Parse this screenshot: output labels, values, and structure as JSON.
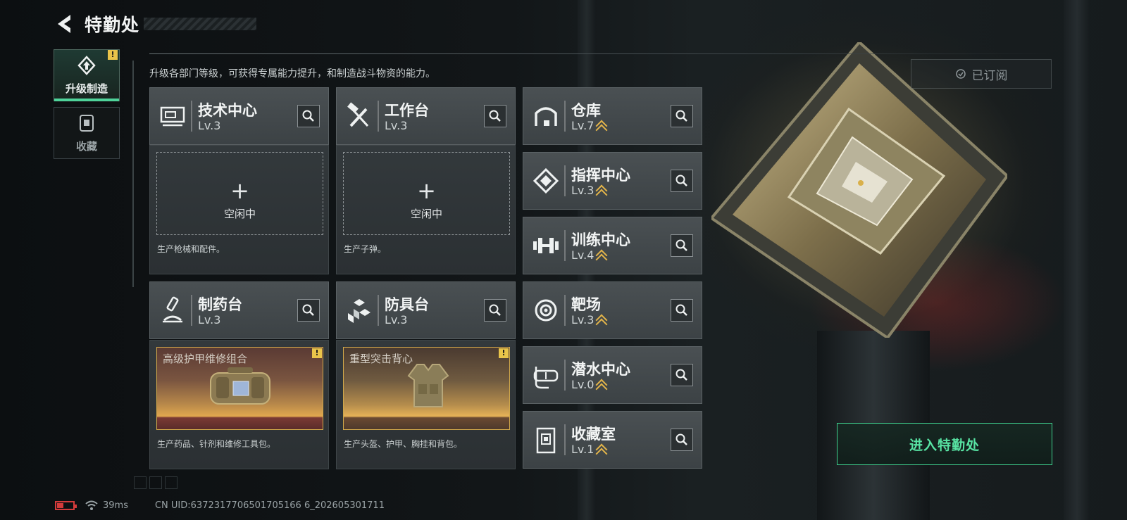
{
  "header": {
    "title": "特勤处"
  },
  "nav": [
    {
      "label": "升级制造",
      "icon": "upgrade-icon",
      "active": true,
      "alert": "!"
    },
    {
      "label": "收藏",
      "icon": "collection-icon",
      "active": false
    }
  ],
  "description": "升级各部门等级，可获得专属能力提升，和制造战斗物资的能力。",
  "departments_left": [
    {
      "name": "技术中心",
      "level": "Lv.3",
      "icon": "tech-center-icon",
      "slot_state": "空闲中",
      "slot_plus": "+",
      "desc": "生产枪械和配件。"
    },
    {
      "name": "工作台",
      "level": "Lv.3",
      "icon": "workbench-icon",
      "slot_state": "空闲中",
      "slot_plus": "+",
      "desc": "生产子弹。"
    },
    {
      "name": "制药台",
      "level": "Lv.3",
      "icon": "pharmacy-icon",
      "craft_item": "高级护甲维修组合",
      "desc": "生产药品、针剂和维修工具包。",
      "alert": "!"
    },
    {
      "name": "防具台",
      "level": "Lv.3",
      "icon": "armor-bench-icon",
      "craft_item": "重型突击背心",
      "desc": "生产头盔、护甲、胸挂和背包。",
      "alert": "!"
    }
  ],
  "departments_right": [
    {
      "name": "仓库",
      "level": "Lv.7",
      "icon": "warehouse-icon"
    },
    {
      "name": "指挥中心",
      "level": "Lv.3",
      "icon": "command-center-icon"
    },
    {
      "name": "训练中心",
      "level": "Lv.4",
      "icon": "training-center-icon"
    },
    {
      "name": "靶场",
      "level": "Lv.3",
      "icon": "shooting-range-icon"
    },
    {
      "name": "潜水中心",
      "level": "Lv.0",
      "icon": "diving-center-icon"
    },
    {
      "name": "收藏室",
      "level": "Lv.1",
      "icon": "collection-room-icon"
    }
  ],
  "subscribed": {
    "label": "已订阅"
  },
  "enter_button": {
    "label": "进入特勤处"
  },
  "status": {
    "ping": "39ms",
    "uid": "CN UID:6372317706501705166 6_202605301711"
  },
  "colors": {
    "accent": "#4fd39a",
    "warning": "#e9c44a",
    "level_arrow": "#e2b44a",
    "battery": "#d23b3b"
  }
}
